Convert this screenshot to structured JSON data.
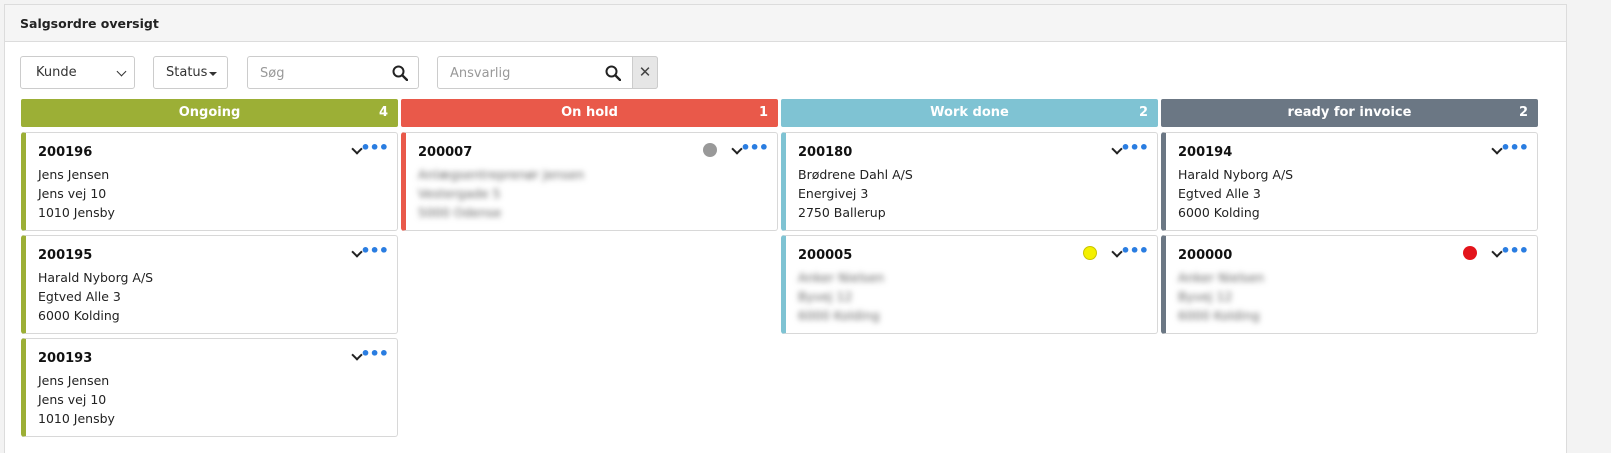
{
  "panel": {
    "title": "Salgsordre oversigt"
  },
  "filters": {
    "customer_select": "Kunde",
    "status_button": "Status",
    "search_placeholder": "Søg",
    "responsible_placeholder": "Ansvarlig"
  },
  "columns": [
    {
      "title": "Ongoing",
      "count": "4",
      "color": "#9caf36",
      "cards": [
        {
          "id": "200196",
          "lines": [
            "Jens Jensen",
            "Jens vej 10",
            "1010 Jensby"
          ]
        },
        {
          "id": "200195",
          "lines": [
            "Harald Nyborg A/S",
            "Egtved Alle 3",
            "6000 Kolding"
          ]
        },
        {
          "id": "200193",
          "lines": [
            "Jens Jensen",
            "Jens vej 10",
            "1010 Jensby"
          ]
        }
      ]
    },
    {
      "title": "On hold",
      "count": "1",
      "color": "#e9594a",
      "cards": [
        {
          "id": "200007",
          "status_dot": "#999999",
          "lines": [
            "Anlægsentreprenør Jensen",
            "Vestergade 5",
            "5000 Odense"
          ]
        }
      ]
    },
    {
      "title": "Work done",
      "count": "2",
      "color": "#7fc3d3",
      "cards": [
        {
          "id": "200180",
          "lines": [
            "Brødrene Dahl A/S",
            "Energivej 3",
            "2750 Ballerup"
          ]
        },
        {
          "id": "200005",
          "status_dot": "#f4f000",
          "lines": [
            "Anker Nielsen",
            "Byvej 12",
            "6000 Kolding"
          ]
        }
      ]
    },
    {
      "title": "ready for invoice",
      "count": "2",
      "color": "#6b7784",
      "cards": [
        {
          "id": "200194",
          "lines": [
            "Harald Nyborg A/S",
            "Egtved Alle 3",
            "6000 Kolding"
          ]
        },
        {
          "id": "200000",
          "status_dot": "#e3141b",
          "lines": [
            "Anker Nielsen",
            "Byvej 12",
            "6000 Kolding"
          ]
        }
      ]
    }
  ]
}
